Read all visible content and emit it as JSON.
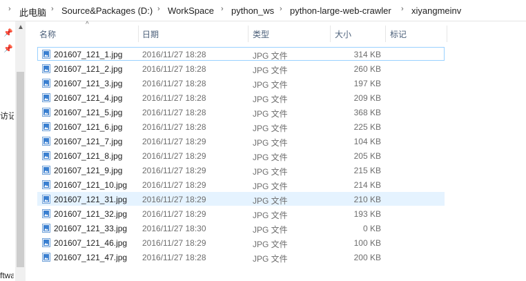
{
  "breadcrumb": {
    "items": [
      "此电脑",
      "Source&Packages (D:)",
      "WorkSpace",
      "python_ws",
      "python-large-web-crawler",
      "xiyangmeinv"
    ]
  },
  "nav": {
    "partial_item_1": "访记录",
    "partial_item_2": "ftwa"
  },
  "columns": {
    "name": "名称",
    "date": "日期",
    "type": "类型",
    "size": "大小",
    "tags": "标记"
  },
  "files": [
    {
      "name": "201607_121_1.jpg",
      "date": "2016/11/27 18:28",
      "type": "JPG 文件",
      "size": "314 KB"
    },
    {
      "name": "201607_121_2.jpg",
      "date": "2016/11/27 18:28",
      "type": "JPG 文件",
      "size": "260 KB"
    },
    {
      "name": "201607_121_3.jpg",
      "date": "2016/11/27 18:28",
      "type": "JPG 文件",
      "size": "197 KB"
    },
    {
      "name": "201607_121_4.jpg",
      "date": "2016/11/27 18:28",
      "type": "JPG 文件",
      "size": "209 KB"
    },
    {
      "name": "201607_121_5.jpg",
      "date": "2016/11/27 18:28",
      "type": "JPG 文件",
      "size": "368 KB"
    },
    {
      "name": "201607_121_6.jpg",
      "date": "2016/11/27 18:28",
      "type": "JPG 文件",
      "size": "225 KB"
    },
    {
      "name": "201607_121_7.jpg",
      "date": "2016/11/27 18:29",
      "type": "JPG 文件",
      "size": "104 KB"
    },
    {
      "name": "201607_121_8.jpg",
      "date": "2016/11/27 18:29",
      "type": "JPG 文件",
      "size": "205 KB"
    },
    {
      "name": "201607_121_9.jpg",
      "date": "2016/11/27 18:29",
      "type": "JPG 文件",
      "size": "215 KB"
    },
    {
      "name": "201607_121_10.jpg",
      "date": "2016/11/27 18:29",
      "type": "JPG 文件",
      "size": "214 KB"
    },
    {
      "name": "201607_121_31.jpg",
      "date": "2016/11/27 18:29",
      "type": "JPG 文件",
      "size": "210 KB"
    },
    {
      "name": "201607_121_32.jpg",
      "date": "2016/11/27 18:29",
      "type": "JPG 文件",
      "size": "193 KB"
    },
    {
      "name": "201607_121_33.jpg",
      "date": "2016/11/27 18:30",
      "type": "JPG 文件",
      "size": "0 KB"
    },
    {
      "name": "201607_121_46.jpg",
      "date": "2016/11/27 18:29",
      "type": "JPG 文件",
      "size": "100 KB"
    },
    {
      "name": "201607_121_47.jpg",
      "date": "2016/11/27 18:28",
      "type": "JPG 文件",
      "size": "200 KB"
    }
  ],
  "state": {
    "focused_row": 0,
    "hovered_row": 10,
    "sort_column": "name"
  },
  "icons": {
    "file": "jpg-file-icon",
    "pin": "pin-icon",
    "chevron": "chevron-right-icon"
  }
}
